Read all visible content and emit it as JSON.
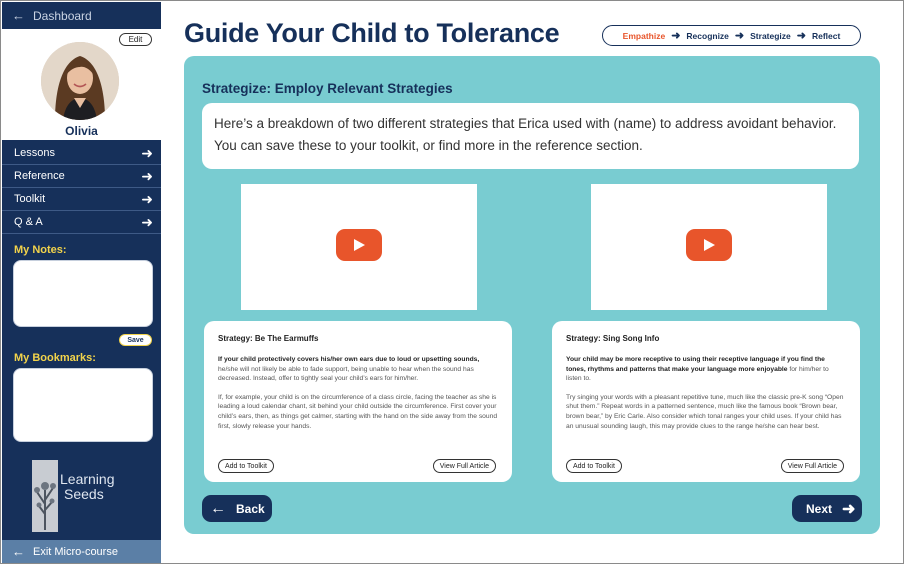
{
  "sidebar": {
    "dashboard_label": "Dashboard",
    "edit_label": "Edit",
    "username": "Olivia",
    "nav_items": [
      {
        "label": "Lessons"
      },
      {
        "label": "Reference"
      },
      {
        "label": "Toolkit"
      },
      {
        "label": "Q & A"
      }
    ],
    "notes_label": "My Notes:",
    "save_label": "Save",
    "bookmarks_label": "My Bookmarks:",
    "logo_text_line1": "Learning",
    "logo_text_line2": "Seeds",
    "exit_label": "Exit Micro-course"
  },
  "header": {
    "title": "Guide Your Child to Tolerance",
    "steps": [
      "Empathize",
      "Recognize",
      "Strategize",
      "Reflect"
    ],
    "active_step": "Empathize"
  },
  "main": {
    "section_heading": "Strategize: Employ Relevant Strategies",
    "intro": "Here’s a breakdown of two different strategies that Erica used with (name) to address avoidant behavior. You can save these to your toolkit, or find more in the reference section.",
    "cards": [
      {
        "title": "Strategy: Be The Earmuffs",
        "p1_bold": "If your child protectively covers his/her own ears due to loud or upsetting sounds,",
        "p1_rest": " he/she will not likely be able to fade support, being unable to hear when the sound has decreased. Instead, offer to tightly seal your child’s ears for him/her.",
        "p2": "If, for example, your child is on the circumference of a class circle, facing the teacher as she is leading a loud calendar chant, sit behind your child outside the circumference. First cover your child’s ears, then, as things get calmer, starting with the hand on the side away from the sound first, slowly release your hands.",
        "add_label": "Add to Toolkit",
        "view_label": "View Full Article"
      },
      {
        "title": "Strategy: Sing Song Info",
        "p1_bold": "Your child may be more receptive to using their receptive language if you find the tones, rhythms and patterns that make your language more enjoyable",
        "p1_rest": " for him/her to listen to.",
        "p2": "Try singing your words with a pleasant repetitive tune, much like the classic pre-K song “Open shut them.” Repeat words in a patterned sentence, much like the famous book “Brown bear, brown bear,” by Eric Carle. Also consider which tonal ranges your child uses. If your child has an unusual sounding laugh, this may provide clues to the range he/she can hear best.",
        "add_label": "Add to Toolkit",
        "view_label": "View Full Article"
      }
    ],
    "back_label": "Back",
    "next_label": "Next"
  },
  "colors": {
    "navy": "#16305a",
    "panel_teal": "#79ccd1",
    "accent_orange": "#e8552b",
    "label_yellow": "#f2d34b"
  },
  "icons": [
    "arrow-left-icon",
    "arrow-right-icon",
    "play-icon",
    "edit-icon"
  ]
}
